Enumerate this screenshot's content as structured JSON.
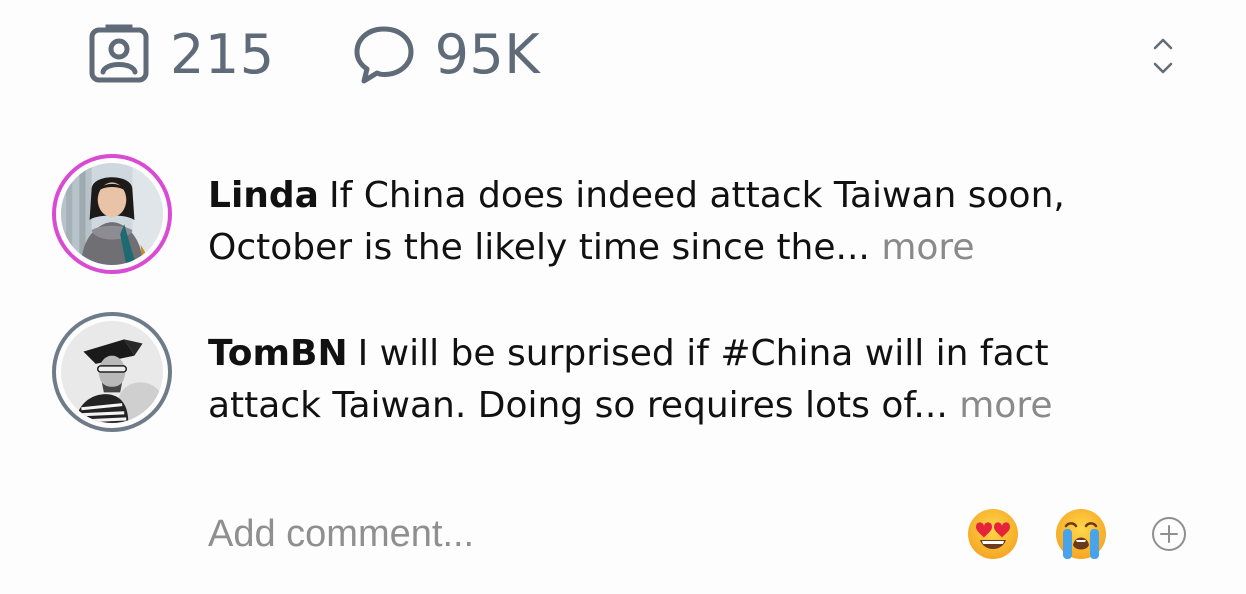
{
  "stats": {
    "reactions": {
      "icon": "contact-badge-icon",
      "count": "215"
    },
    "comments": {
      "icon": "speech-bubble-icon",
      "count": "95K"
    },
    "expand_icon": "expand-collapse-icon"
  },
  "comments": [
    {
      "username": "Linda",
      "text": "If China does indeed attack Taiwan soon, October is the likely time since the...",
      "more_label": "more",
      "ring_color": "#d94bd3"
    },
    {
      "username": "TomBN",
      "text": "I will be surprised if #China will in fact attack Taiwan. Doing so requires lots of...",
      "more_label": "more",
      "ring_color": "#6e7c89"
    }
  ],
  "composer": {
    "placeholder": "Add comment...",
    "quick_reactions": [
      "heart-eyes-emoji-icon",
      "crying-emoji-icon"
    ],
    "add_icon": "plus-circle-icon"
  },
  "colors": {
    "stat_gray": "#5f6b78",
    "more_gray": "#8a8a8a",
    "placeholder_gray": "#8f8f8f"
  }
}
